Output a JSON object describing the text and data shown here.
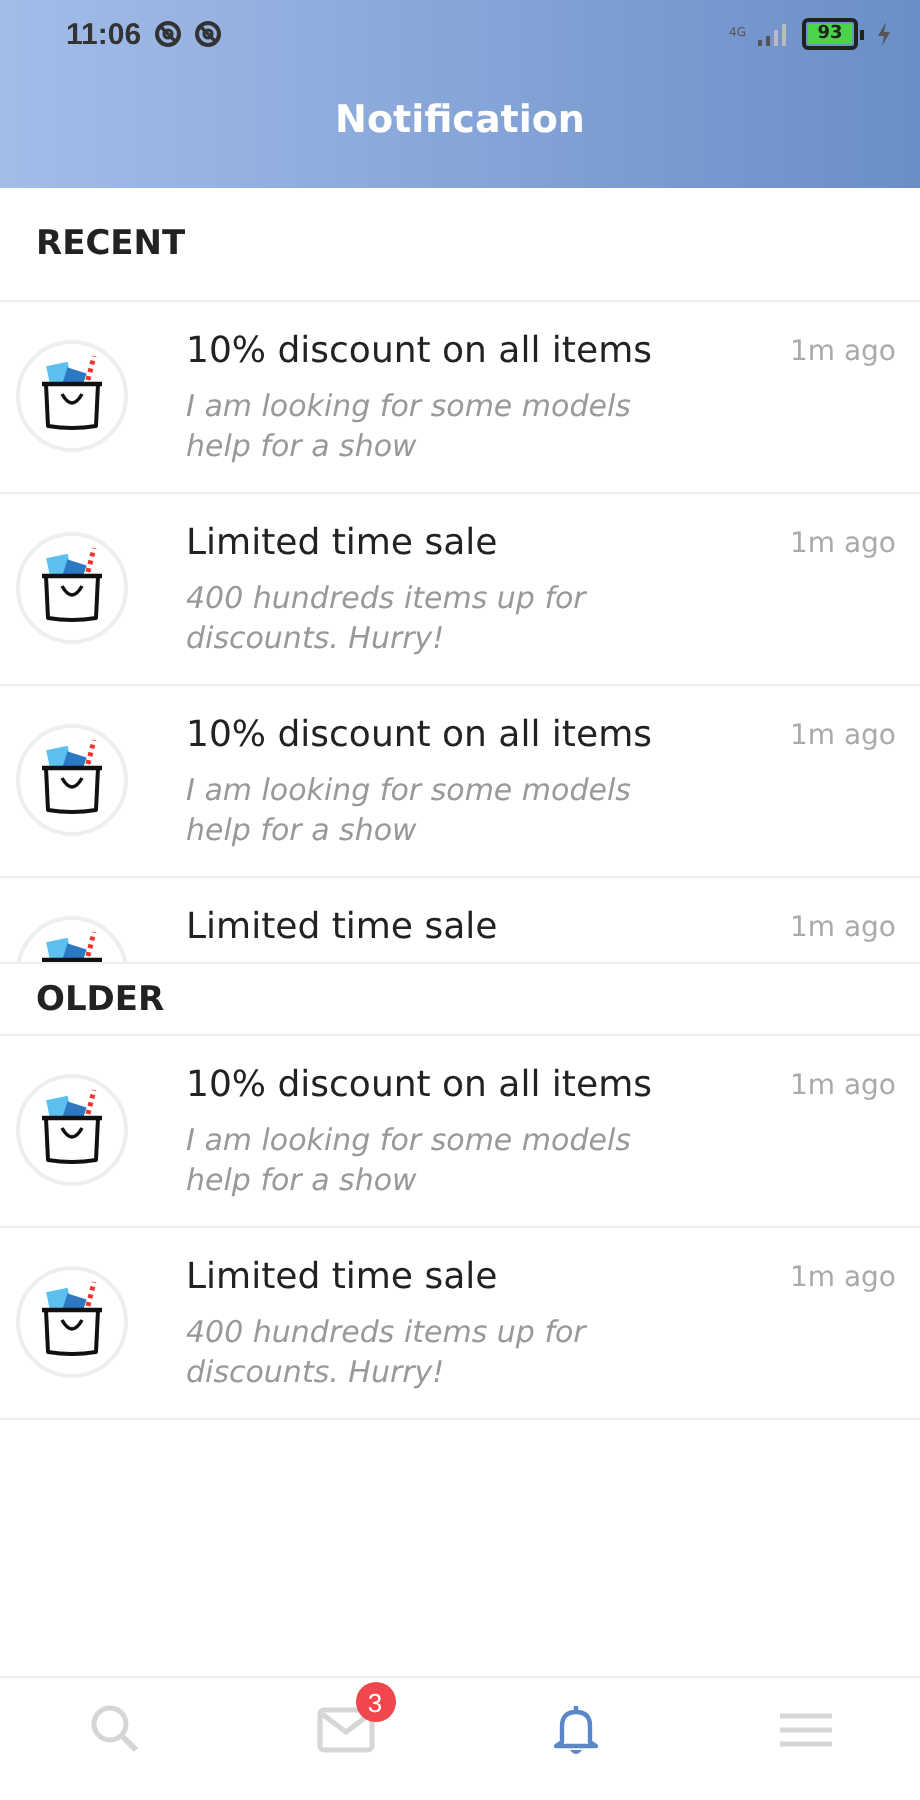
{
  "status_bar": {
    "time": "11:06",
    "network": "4G",
    "battery": "93"
  },
  "header": {
    "title": "Notification"
  },
  "sections": [
    {
      "title": "RECENT",
      "items": [
        {
          "kind": "full",
          "title": "10% discount on all items",
          "description": "I am looking for some models help for a show",
          "time": "1m ago"
        },
        {
          "kind": "full",
          "title": "Limited time sale",
          "description": "400 hundreds items up for discounts. Hurry!",
          "time": "1m ago"
        },
        {
          "kind": "full",
          "title": "10% discount on all items",
          "description": "I am looking for some models help for a show",
          "time": "1m ago"
        },
        {
          "kind": "clipped",
          "title": "Limited time sale",
          "time": "1m ago"
        }
      ]
    },
    {
      "title": "OLDER",
      "items": [
        {
          "kind": "full",
          "title": "10% discount on all items",
          "description": "I am looking for some models help for a show",
          "time": "1m ago"
        },
        {
          "kind": "full",
          "title": "Limited time sale",
          "description": "400 hundreds items up for discounts. Hurry!",
          "time": "1m ago"
        }
      ]
    }
  ],
  "bottom_nav": [
    {
      "kind": "search",
      "selected": false
    },
    {
      "kind": "mail",
      "selected": false,
      "badge": "3"
    },
    {
      "kind": "bell",
      "selected": true
    },
    {
      "kind": "menu",
      "selected": false
    }
  ]
}
